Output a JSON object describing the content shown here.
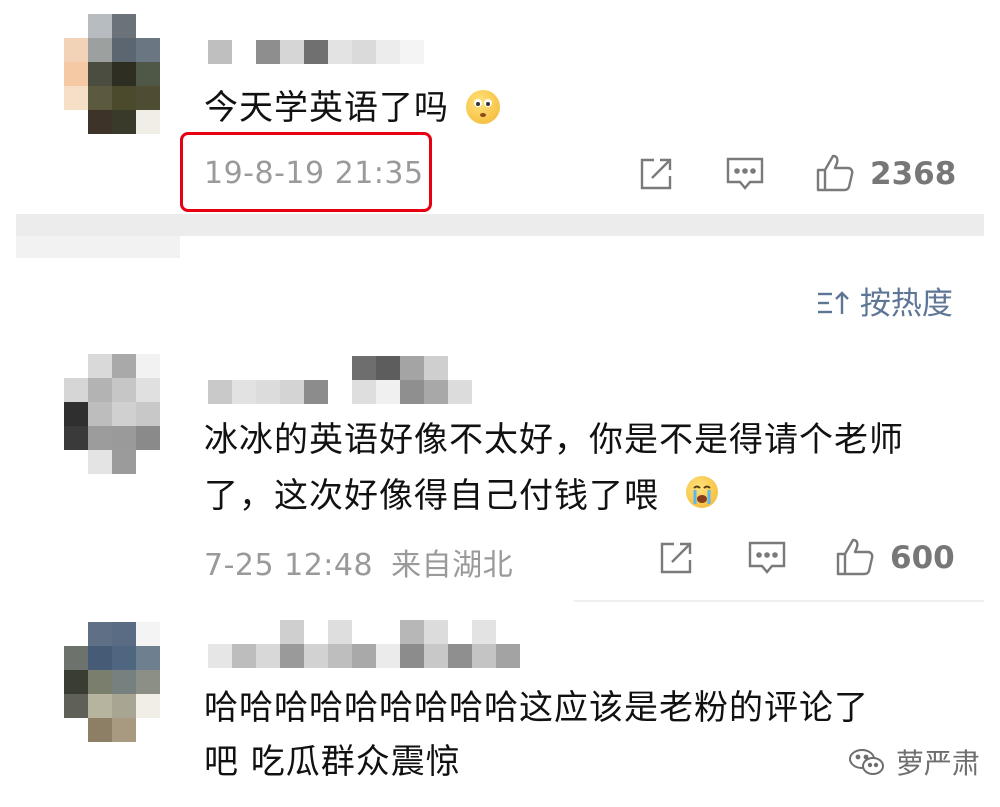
{
  "comments": [
    {
      "text_lines": [
        "今天学英语了吗"
      ],
      "timestamp": "19-8-19 21:35",
      "location": "",
      "likes": "2368"
    },
    {
      "text_lines": [
        "冰冰的英语好像不太好，你是不是得请个老师",
        "了，这次好像得自己付钱了喂"
      ],
      "timestamp": "7-25 12:48",
      "location": "来自湖北",
      "likes": "600"
    },
    {
      "text_lines": [
        "哈哈哈哈哈哈哈哈哈这应该是老粉的评论了",
        "吧 吃瓜群众震惊"
      ],
      "timestamp": "",
      "location": "",
      "likes": ""
    }
  ],
  "sort": {
    "label": "按热度"
  },
  "watermark": {
    "text": "萝严肃"
  },
  "colors": {
    "highlight": "#e60012",
    "link_blue": "#5e7696",
    "meta_gray": "#9a9a9a"
  }
}
